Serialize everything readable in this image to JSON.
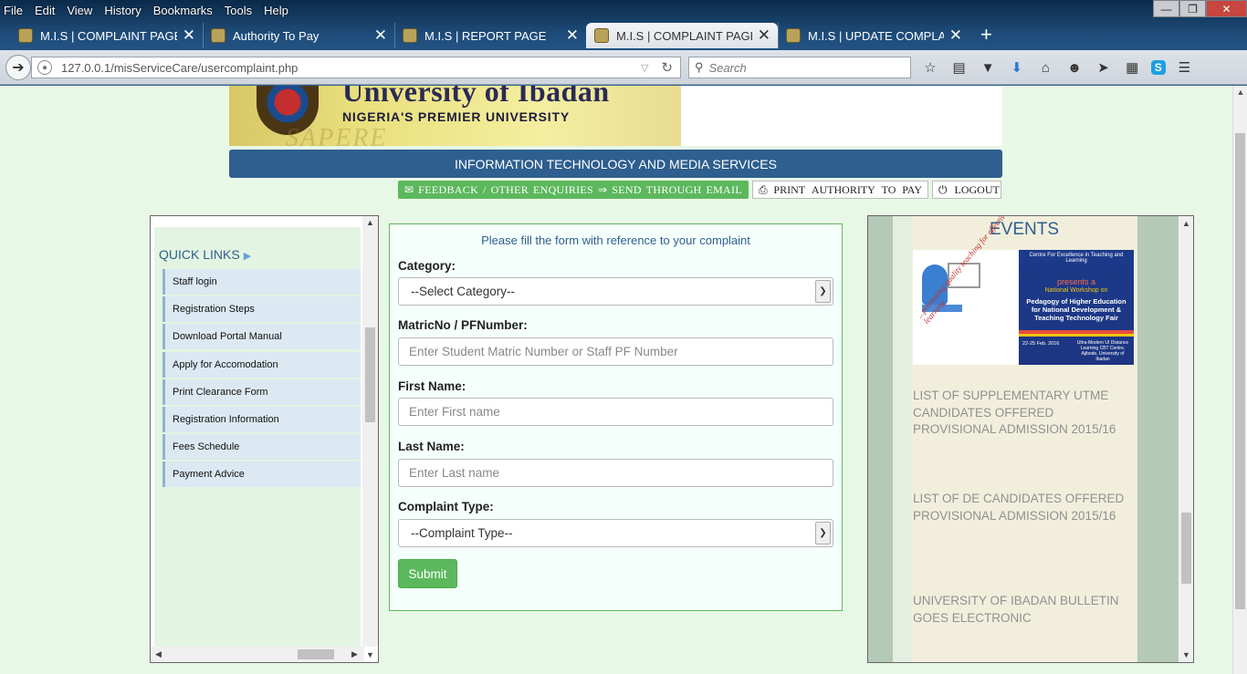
{
  "browser": {
    "menu": [
      "File",
      "Edit",
      "View",
      "History",
      "Bookmarks",
      "Tools",
      "Help"
    ],
    "tabs": [
      {
        "label": "M.I.S | COMPLAINT PAGE",
        "active": false
      },
      {
        "label": "Authority To Pay",
        "active": false
      },
      {
        "label": "M.I.S | REPORT PAGE",
        "active": false
      },
      {
        "label": "M.I.S | COMPLAINT PAGE",
        "active": true
      },
      {
        "label": "M.I.S | UPDATE COMPLAI...",
        "active": false
      }
    ],
    "new_tab": "+",
    "url": "127.0.0.1/misServiceCare/usercomplaint.php",
    "search_placeholder": "Search"
  },
  "banner": {
    "university": "University of Ibadan",
    "tagline": "NIGERIA'S PREMIER UNIVERSITY",
    "motto": "SAPERE"
  },
  "header": {
    "department": "INFORMATION TECHNOLOGY AND MEDIA SERVICES",
    "feedback": [
      "FEEDBACK",
      "/",
      "OTHER",
      "ENQUIRIES",
      "⇒",
      "SEND",
      "THROUGH",
      "EMAIL"
    ],
    "print_authority": [
      "PRINT",
      "AUTHORITY",
      "TO",
      "PAY"
    ],
    "logout": "LOGOUT"
  },
  "quick_links": {
    "title": "QUICK LINKS",
    "items": [
      "Staff login",
      "Registration Steps",
      "Download Portal Manual",
      "Apply for Accomodation",
      "Print Clearance Form",
      "Registration Information",
      "Fees Schedule",
      "Payment Advice"
    ]
  },
  "form": {
    "intro": "Please fill the form with reference to your complaint",
    "category_label": "Category:",
    "category_value": "--Select Category--",
    "matric_label": "MatricNo / PFNumber:",
    "matric_placeholder": "Enter Student Matric Number or Staff PF Number",
    "first_name_label": "First Name:",
    "first_name_placeholder": "Enter First name",
    "last_name_label": "Last Name:",
    "last_name_placeholder": "Enter Last name",
    "complaint_type_label": "Complaint Type:",
    "complaint_type_value": "--Complaint Type--",
    "submit": "Submit"
  },
  "events": {
    "title": "EVENTS",
    "poster": {
      "slogan": "...promoting quality teaching for effective learning",
      "line1": "Centre For Excellence in Teaching and Learning",
      "line3": "presents a",
      "line4": "National Workshop on",
      "line5": "Pedagogy of Higher Education for National Development & Teaching Technology Fair",
      "date": "22-25 Feb. 2016",
      "venue": "Ultra-Modern UI Distance Learning CBT Centre, Ajibode, University of Ibadan"
    },
    "news": [
      "LIST OF SUPPLEMENTARY UTME CANDIDATES OFFERED PROVISIONAL ADMISSION 2015/16",
      "LIST OF DE CANDIDATES OFFERED PROVISIONAL ADMISSION 2015/16",
      "UNIVERSITY OF IBADAN BULLETIN GOES ELECTRONIC"
    ]
  },
  "icons": {
    "toolbar": [
      "star-icon",
      "reading-list-icon",
      "pocket-icon",
      "download-icon",
      "home-icon",
      "smiley-icon",
      "send-icon",
      "windows-icon",
      "skype-icon",
      "menu-icon"
    ]
  }
}
